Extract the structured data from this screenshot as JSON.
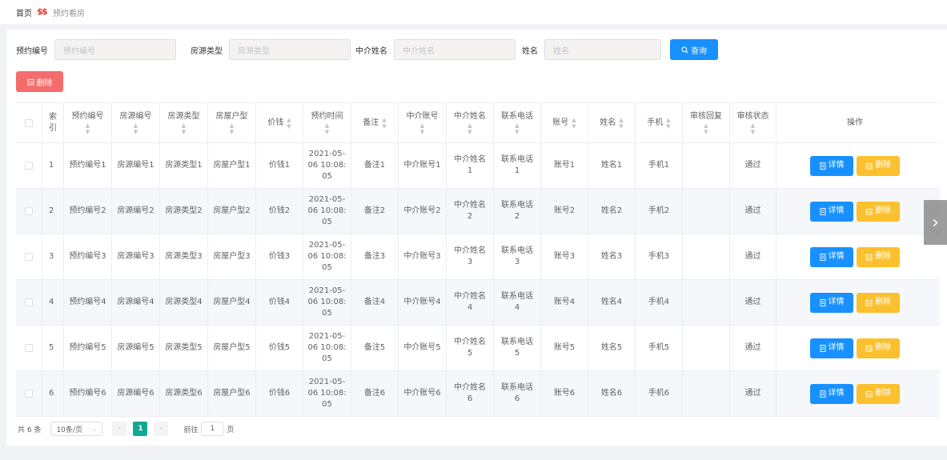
{
  "breadcrumb": {
    "home": "首页",
    "current": "预约看房"
  },
  "search": {
    "f1_label": "预约编号",
    "f1_placeholder": "预约编号",
    "f2_label": "房源类型",
    "f2_placeholder": "房源类型",
    "f3_label": "中介姓名",
    "f3_placeholder": "中介姓名",
    "f4_label": "姓名",
    "f4_placeholder": "姓名",
    "query_label": "查询"
  },
  "toolbar": {
    "delete_label": "删除"
  },
  "table": {
    "headers": [
      "索引",
      "预约编号",
      "房源编号",
      "房源类型",
      "房屋户型",
      "价钱",
      "预约时间",
      "备注",
      "中介账号",
      "中介姓名",
      "联系电话",
      "账号",
      "姓名",
      "手机",
      "审核回复",
      "审核状态",
      "操作"
    ],
    "index_header_l1": "索",
    "index_header_l2": "引",
    "detail_label": "详情",
    "delete_label": "删除",
    "rows": [
      {
        "idx": "1",
        "yybh": "预约编号1",
        "fybh": "房源编号1",
        "fylx": "房源类型1",
        "fwhx": "房屋户型1",
        "jq": "价钱1",
        "t1": "2021-05-",
        "t2": "06 10:08:",
        "t3": "05",
        "bz": "备注1",
        "zjzh": "中介账号1",
        "zjxm1": "中介姓名",
        "zjxm2": "1",
        "lxdh1": "联系电话",
        "lxdh2": "1",
        "zh": "账号1",
        "xm": "姓名1",
        "sj": "手机1",
        "shhf": "",
        "shzt": "通过"
      },
      {
        "idx": "2",
        "yybh": "预约编号2",
        "fybh": "房源编号2",
        "fylx": "房源类型2",
        "fwhx": "房屋户型2",
        "jq": "价钱2",
        "t1": "2021-05-",
        "t2": "06 10:08:",
        "t3": "05",
        "bz": "备注2",
        "zjzh": "中介账号2",
        "zjxm1": "中介姓名",
        "zjxm2": "2",
        "lxdh1": "联系电话",
        "lxdh2": "2",
        "zh": "账号2",
        "xm": "姓名2",
        "sj": "手机2",
        "shhf": "",
        "shzt": "通过"
      },
      {
        "idx": "3",
        "yybh": "预约编号3",
        "fybh": "房源编号3",
        "fylx": "房源类型3",
        "fwhx": "房屋户型3",
        "jq": "价钱3",
        "t1": "2021-05-",
        "t2": "06 10:08:",
        "t3": "05",
        "bz": "备注3",
        "zjzh": "中介账号3",
        "zjxm1": "中介姓名",
        "zjxm2": "3",
        "lxdh1": "联系电话",
        "lxdh2": "3",
        "zh": "账号3",
        "xm": "姓名3",
        "sj": "手机3",
        "shhf": "",
        "shzt": "通过"
      },
      {
        "idx": "4",
        "yybh": "预约编号4",
        "fybh": "房源编号4",
        "fylx": "房源类型4",
        "fwhx": "房屋户型4",
        "jq": "价钱4",
        "t1": "2021-05-",
        "t2": "06 10:08:",
        "t3": "05",
        "bz": "备注4",
        "zjzh": "中介账号4",
        "zjxm1": "中介姓名",
        "zjxm2": "4",
        "lxdh1": "联系电话",
        "lxdh2": "4",
        "zh": "账号4",
        "xm": "姓名4",
        "sj": "手机4",
        "shhf": "",
        "shzt": "通过"
      },
      {
        "idx": "5",
        "yybh": "预约编号5",
        "fybh": "房源编号5",
        "fylx": "房源类型5",
        "fwhx": "房屋户型5",
        "jq": "价钱5",
        "t1": "2021-05-",
        "t2": "06 10:08:",
        "t3": "05",
        "bz": "备注5",
        "zjzh": "中介账号5",
        "zjxm1": "中介姓名",
        "zjxm2": "5",
        "lxdh1": "联系电话",
        "lxdh2": "5",
        "zh": "账号5",
        "xm": "姓名5",
        "sj": "手机5",
        "shhf": "",
        "shzt": "通过"
      },
      {
        "idx": "6",
        "yybh": "预约编号6",
        "fybh": "房源编号6",
        "fylx": "房源类型6",
        "fwhx": "房屋户型6",
        "jq": "价钱6",
        "t1": "2021-05-",
        "t2": "06 10:08:",
        "t3": "05",
        "bz": "备注6",
        "zjzh": "中介账号6",
        "zjxm1": "中介姓名",
        "zjxm2": "6",
        "lxdh1": "联系电话",
        "lxdh2": "6",
        "zh": "账号6",
        "xm": "姓名6",
        "sj": "手机6",
        "shhf": "",
        "shzt": "通过"
      }
    ]
  },
  "pagination": {
    "total": "共 6 条",
    "page_size": "10条/页",
    "current_page": "1",
    "goto_label": "前往",
    "goto_value": "1",
    "page_unit": "页"
  },
  "icons": {
    "query": "search-icon",
    "delete": "trash-icon",
    "detail": "document-icon",
    "prev": "chevron-left-icon",
    "next": "chevron-right-icon",
    "drawer": "chevron-right-icon"
  },
  "colors": {
    "primary": "#1890ff",
    "danger": "#f56c6c",
    "warning": "#fbc02d",
    "page_active": "#13a891"
  }
}
